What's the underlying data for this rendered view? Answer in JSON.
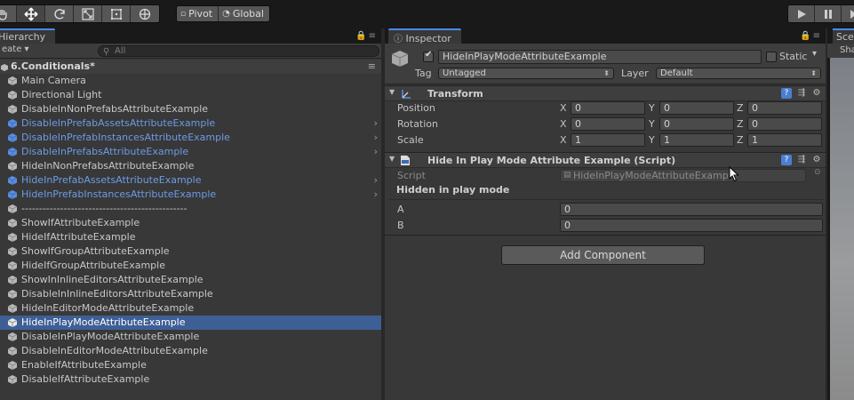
{
  "toolbar": {
    "tools": [
      "hand-icon",
      "move-icon",
      "rotate-icon",
      "scale-icon",
      "rect-icon",
      "transform-icon"
    ],
    "pivot_label": "Pivot",
    "global_label": "Global",
    "play_controls": [
      "play-icon",
      "pause-icon",
      "step-icon"
    ]
  },
  "hierarchy": {
    "tab_label": "Hierarchy",
    "create_label": "eate",
    "search_placeholder": "All",
    "scene_name": "6.Conditionals*",
    "items": [
      {
        "label": "Main Camera",
        "prefab": false
      },
      {
        "label": "Directional Light",
        "prefab": false
      },
      {
        "label": "DisableInNonPrefabsAttributeExample",
        "prefab": false
      },
      {
        "label": "DisableInPrefabAssetsAttributeExample",
        "prefab": true
      },
      {
        "label": "DisableInPrefabInstancesAttributeExample",
        "prefab": true
      },
      {
        "label": "DisableInPrefabsAttributeExample",
        "prefab": true
      },
      {
        "label": "HideInNonPrefabsAttributeExample",
        "prefab": false
      },
      {
        "label": "HideInPrefabAssetsAttributeExample",
        "prefab": true
      },
      {
        "label": "HideInPrefabInstancesAttributeExample",
        "prefab": true
      },
      {
        "label": "-----------------------------------------------",
        "prefab": false
      },
      {
        "label": "ShowIfAttributeExample",
        "prefab": false
      },
      {
        "label": "HideIfAttributeExample",
        "prefab": false
      },
      {
        "label": "ShowIfGroupAttributeExample",
        "prefab": false
      },
      {
        "label": "HideIfGroupAttributeExample",
        "prefab": false
      },
      {
        "label": "ShowInInlineEditorsAttributeExample",
        "prefab": false
      },
      {
        "label": "DisableInInlineEditorsAttributeExample",
        "prefab": false
      },
      {
        "label": "HideInEditorModeAttributeExample",
        "prefab": false
      },
      {
        "label": "HideInPlayModeAttributeExample",
        "prefab": false,
        "selected": true
      },
      {
        "label": "DisableInPlayModeAttributeExample",
        "prefab": false
      },
      {
        "label": "DisableInEditorModeAttributeExample",
        "prefab": false
      },
      {
        "label": "EnableIfAttributeExample",
        "prefab": false
      },
      {
        "label": "DisableIfAttributeExample",
        "prefab": false
      }
    ]
  },
  "inspector": {
    "tab_label": "Inspector",
    "object_name": "HideInPlayModeAttributeExample",
    "static_label": "Static",
    "tag_label": "Tag",
    "tag_value": "Untagged",
    "layer_label": "Layer",
    "layer_value": "Default",
    "transform": {
      "title": "Transform",
      "position_label": "Position",
      "rotation_label": "Rotation",
      "scale_label": "Scale",
      "axes": [
        "X",
        "Y",
        "Z"
      ],
      "position": [
        "0",
        "0",
        "0"
      ],
      "rotation": [
        "0",
        "0",
        "0"
      ],
      "scale": [
        "1",
        "1",
        "1"
      ]
    },
    "script_component": {
      "title": "Hide In Play Mode Attribute Example (Script)",
      "script_label": "Script",
      "script_value": "HideInPlayModeAttributeExample",
      "group_title": "Hidden in play mode",
      "a_label": "A",
      "a_value": "0",
      "b_label": "B",
      "b_value": "0"
    },
    "add_component_label": "Add Component"
  },
  "scene": {
    "tab_label": "Sce",
    "strip_label": "Sha"
  }
}
